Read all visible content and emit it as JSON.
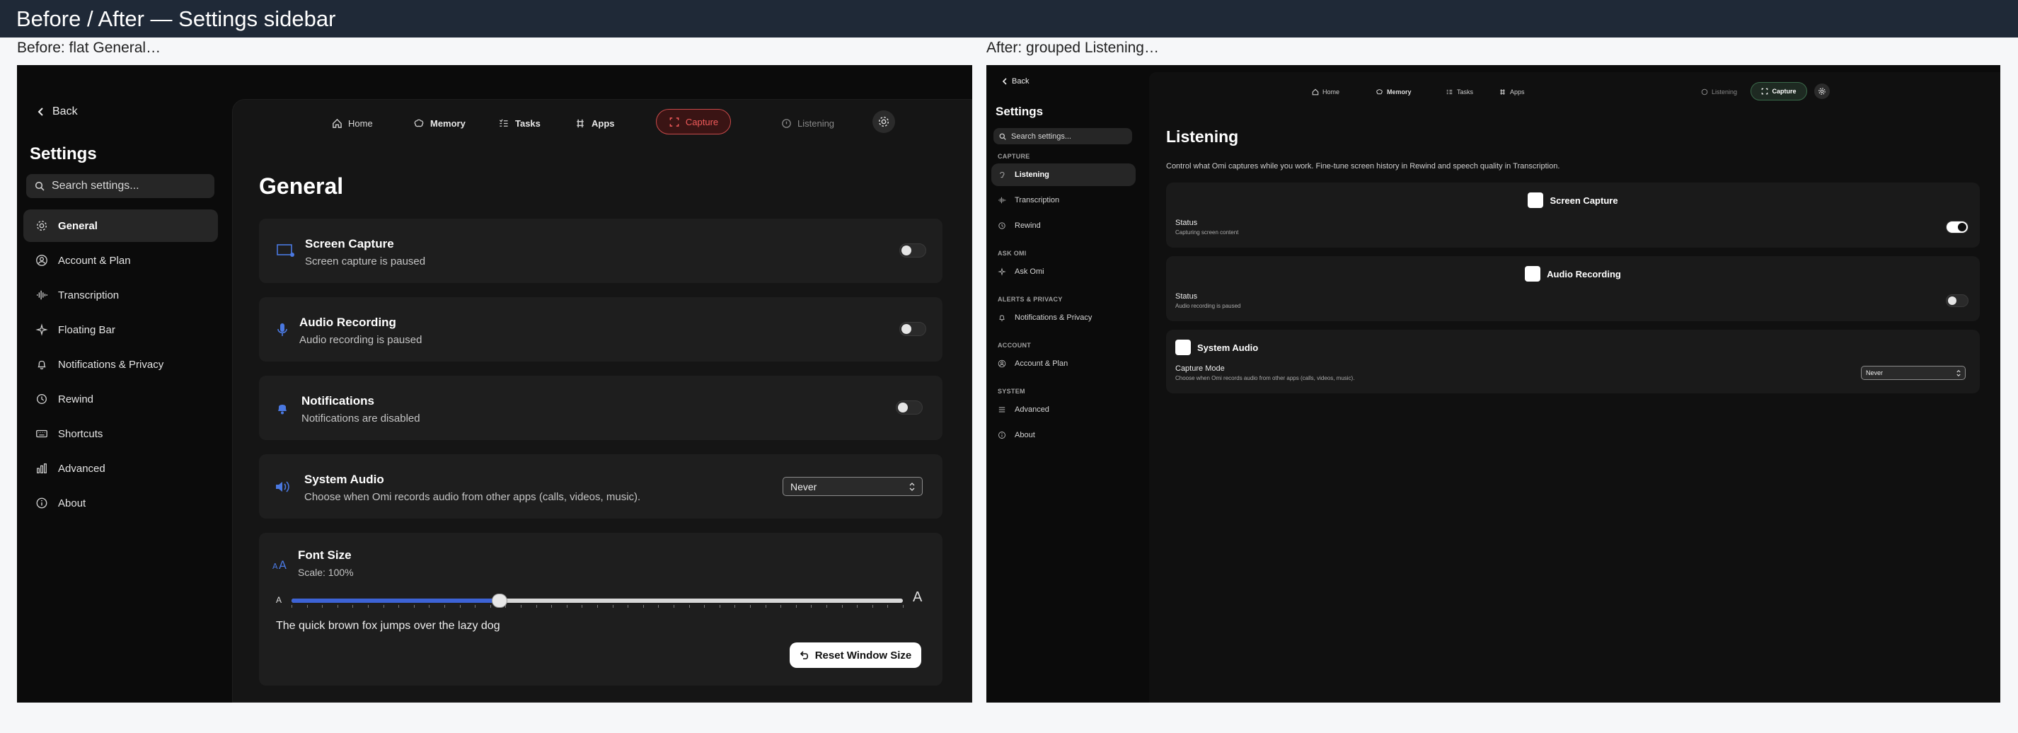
{
  "page_title": "Before / After — Settings sidebar",
  "before": {
    "caption": "Before: flat General…",
    "back": "Back",
    "title": "Settings",
    "search_placeholder": "Search settings...",
    "nav": [
      {
        "label": "General",
        "icon": "gear-icon",
        "active": true
      },
      {
        "label": "Account & Plan",
        "icon": "user-circle-icon"
      },
      {
        "label": "Transcription",
        "icon": "waveform-icon"
      },
      {
        "label": "Floating Bar",
        "icon": "sparkle-icon"
      },
      {
        "label": "Notifications & Privacy",
        "icon": "bell-icon"
      },
      {
        "label": "Rewind",
        "icon": "history-icon"
      },
      {
        "label": "Shortcuts",
        "icon": "keyboard-icon"
      },
      {
        "label": "Advanced",
        "icon": "chart-bars-icon"
      },
      {
        "label": "About",
        "icon": "info-icon"
      }
    ],
    "topnav": {
      "home": "Home",
      "memory": "Memory",
      "tasks": "Tasks",
      "apps": "Apps",
      "capture": "Capture",
      "listening": "Listening"
    },
    "heading": "General",
    "cards": {
      "screen": {
        "title": "Screen Capture",
        "subtitle": "Screen capture is paused",
        "toggle": false
      },
      "audio": {
        "title": "Audio Recording",
        "subtitle": "Audio recording is paused",
        "toggle": false
      },
      "notif": {
        "title": "Notifications",
        "subtitle": "Notifications are disabled",
        "toggle": false
      },
      "system": {
        "title": "System Audio",
        "subtitle": "Choose when Omi records audio from other apps (calls, videos, music).",
        "value": "Never"
      },
      "font": {
        "title": "Font Size",
        "scale": "Scale: 100%",
        "small_a": "A",
        "large_a": "A",
        "slider_fraction": 0.34,
        "sample": "The quick brown fox jumps over the lazy dog",
        "reset": "Reset Window Size"
      }
    }
  },
  "after": {
    "caption": "After: grouped Listening…",
    "back": "Back",
    "title": "Settings",
    "search_placeholder": "Search settings...",
    "sections": [
      {
        "header": "CAPTURE",
        "items": [
          {
            "label": "Listening",
            "icon": "ear-icon",
            "active": true
          },
          {
            "label": "Transcription",
            "icon": "waveform-icon"
          },
          {
            "label": "Rewind",
            "icon": "history-icon"
          }
        ]
      },
      {
        "header": "ASK OMI",
        "items": [
          {
            "label": "Ask Omi",
            "icon": "sparkle-icon"
          }
        ]
      },
      {
        "header": "ALERTS & PRIVACY",
        "items": [
          {
            "label": "Notifications & Privacy",
            "icon": "bell-icon"
          }
        ]
      },
      {
        "header": "ACCOUNT",
        "items": [
          {
            "label": "Account & Plan",
            "icon": "user-circle-icon"
          }
        ]
      },
      {
        "header": "SYSTEM",
        "items": [
          {
            "label": "Advanced",
            "icon": "sliders-icon"
          },
          {
            "label": "About",
            "icon": "info-icon"
          }
        ]
      }
    ],
    "topnav": {
      "home": "Home",
      "memory": "Memory",
      "tasks": "Tasks",
      "apps": "Apps",
      "listening": "Listening",
      "capture": "Capture"
    },
    "heading": "Listening",
    "description": "Control what Omi captures while you work. Fine-tune screen history in Rewind and speech quality in Transcription.",
    "cards": {
      "screen": {
        "title": "Screen Capture",
        "label": "Status",
        "sub": "Capturing screen content",
        "toggle": true
      },
      "audio": {
        "title": "Audio Recording",
        "label": "Status",
        "sub": "Audio recording is paused",
        "toggle": false
      },
      "system": {
        "title": "System Audio",
        "label": "Capture Mode",
        "sub": "Choose when Omi records audio from other apps (calls, videos, music).",
        "value": "Never"
      }
    }
  }
}
